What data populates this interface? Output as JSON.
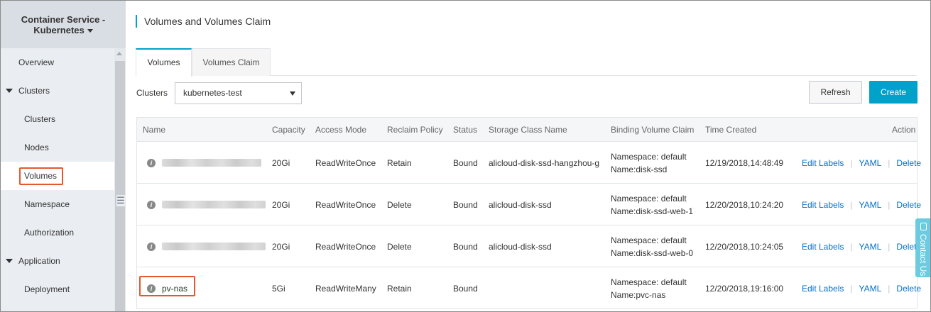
{
  "sidebar": {
    "title_line1": "Container Service -",
    "title_line2": "Kubernetes",
    "items": [
      {
        "label": "Overview"
      },
      {
        "label": "Clusters"
      },
      {
        "label": "Clusters"
      },
      {
        "label": "Nodes"
      },
      {
        "label": "Volumes"
      },
      {
        "label": "Namespace"
      },
      {
        "label": "Authorization"
      },
      {
        "label": "Application"
      },
      {
        "label": "Deployment"
      }
    ]
  },
  "page": {
    "title": "Volumes and Volumes Claim",
    "tabs": [
      {
        "label": "Volumes"
      },
      {
        "label": "Volumes Claim"
      }
    ],
    "clusters_label": "Clusters",
    "cluster_selected": "kubernetes-test",
    "refresh_label": "Refresh",
    "create_label": "Create"
  },
  "table": {
    "columns": [
      "Name",
      "Capacity",
      "Access Mode",
      "Reclaim Policy",
      "Status",
      "Storage Class Name",
      "Binding Volume Claim",
      "Time Created",
      "Action"
    ],
    "rows": [
      {
        "name": "",
        "capacity": "20Gi",
        "access": "ReadWriteOnce",
        "reclaim": "Retain",
        "status": "Bound",
        "storage_class": "alicloud-disk-ssd-hangzhou-g",
        "claim_ns": "Namespace: default",
        "claim_name": "Name:disk-ssd",
        "created": "12/19/2018,14:48:49"
      },
      {
        "name": "",
        "capacity": "20Gi",
        "access": "ReadWriteOnce",
        "reclaim": "Delete",
        "status": "Bound",
        "storage_class": "alicloud-disk-ssd",
        "claim_ns": "Namespace: default",
        "claim_name": "Name:disk-ssd-web-1",
        "created": "12/20/2018,10:24:20"
      },
      {
        "name": "",
        "capacity": "20Gi",
        "access": "ReadWriteOnce",
        "reclaim": "Delete",
        "status": "Bound",
        "storage_class": "alicloud-disk-ssd",
        "claim_ns": "Namespace: default",
        "claim_name": "Name:disk-ssd-web-0",
        "created": "12/20/2018,10:24:05"
      },
      {
        "name": "pv-nas",
        "capacity": "5Gi",
        "access": "ReadWriteMany",
        "reclaim": "Retain",
        "status": "Bound",
        "storage_class": "",
        "claim_ns": "Namespace: default",
        "claim_name": "Name:pvc-nas",
        "created": "12/20/2018,19:16:00"
      }
    ],
    "actions": {
      "edit": "Edit Labels",
      "yaml": "YAML",
      "delete": "Delete",
      "sep": "|"
    }
  },
  "contact": {
    "label": "Contact Us"
  },
  "colors": {
    "accent": "#00a2ca",
    "link": "#0070cc",
    "highlight": "#e4572e"
  }
}
